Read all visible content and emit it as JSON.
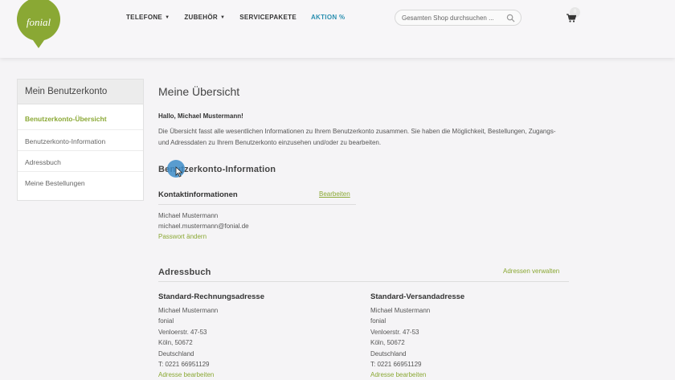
{
  "colors": {
    "accent_green": "#8aa834",
    "nav_accent": "#2a8fb0",
    "logo_green": "#8aa834"
  },
  "header": {
    "logo_text": "fonial",
    "nav": [
      {
        "label": "TELEFONE",
        "has_dropdown": true
      },
      {
        "label": "ZUBEHÖR",
        "has_dropdown": true
      },
      {
        "label": "SERVICEPAKETE",
        "has_dropdown": false
      },
      {
        "label": "AKTION %",
        "has_dropdown": false
      }
    ],
    "search_placeholder": "Gesamten Shop durchsuchen ...",
    "cart_icon": "cart-icon",
    "cart_count": "0"
  },
  "sidebar": {
    "title": "Mein Benutzerkonto",
    "items": [
      {
        "label": "Benutzerkonto-Übersicht",
        "active": true
      },
      {
        "label": "Benutzerkonto-Information",
        "active": false
      },
      {
        "label": "Adressbuch",
        "active": false
      },
      {
        "label": "Meine Bestellungen",
        "active": false
      }
    ]
  },
  "main": {
    "title": "Meine Übersicht",
    "greeting": "Hallo, Michael Mustermann!",
    "intro": "Die Übersicht fasst alle wesentlichen Informationen zu Ihrem Benutzerkonto zusammen. Sie haben die Möglichkeit, Bestellungen, Zugangs- und Adressdaten zu Ihrem Benutzerkonto einzusehen und/oder zu bearbeiten.",
    "account_info": {
      "title": "Benutzerkonto-Information",
      "contact_title": "Kontaktinformationen",
      "edit_label": "Bearbeiten",
      "name": "Michael Mustermann",
      "email": "michael.mustermann@fonial.de",
      "change_password": "Passwort ändern"
    },
    "address_book": {
      "title": "Adressbuch",
      "manage_label": "Adressen verwalten",
      "billing": {
        "title": "Standard-Rechnungsadresse",
        "lines": [
          "Michael Mustermann",
          "fonial",
          "Venloerstr. 47-53",
          "Köln, 50672",
          "Deutschland",
          "T: 0221 66951129"
        ],
        "edit_label": "Adresse bearbeiten"
      },
      "shipping": {
        "title": "Standard-Versandadresse",
        "lines": [
          "Michael Mustermann",
          "fonial",
          "Venloerstr. 47-53",
          "Köln, 50672",
          "Deutschland",
          "T: 0221 66951129"
        ],
        "edit_label": "Adresse bearbeiten"
      }
    }
  }
}
